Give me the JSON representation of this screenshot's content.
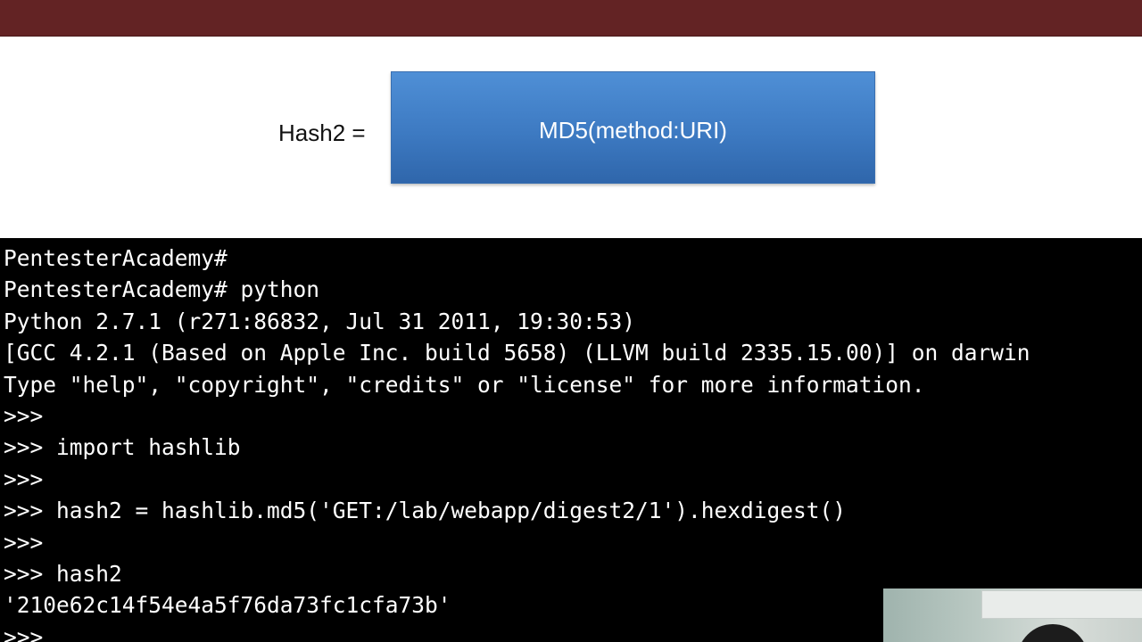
{
  "slide": {
    "label": "Hash2 =",
    "formula": "MD5(method:URI)",
    "colors": {
      "top_bar": "#632324",
      "formula_box": "#3d7ac2",
      "terminal_bg": "#000000",
      "terminal_text": "#ffffff"
    }
  },
  "terminal": {
    "lines": [
      "PentesterAcademy#",
      "PentesterAcademy# python",
      "Python 2.7.1 (r271:86832, Jul 31 2011, 19:30:53)",
      "[GCC 4.2.1 (Based on Apple Inc. build 5658) (LLVM build 2335.15.00)] on darwin",
      "Type \"help\", \"copyright\", \"credits\" or \"license\" for more information.",
      ">>>",
      ">>> import hashlib",
      ">>>",
      ">>> hash2 = hashlib.md5('GET:/lab/webapp/digest2/1').hexdigest()",
      ">>>",
      ">>> hash2",
      "'210e62c14f54e4a5f76da73fc1cfa73b'",
      ">>>"
    ]
  }
}
